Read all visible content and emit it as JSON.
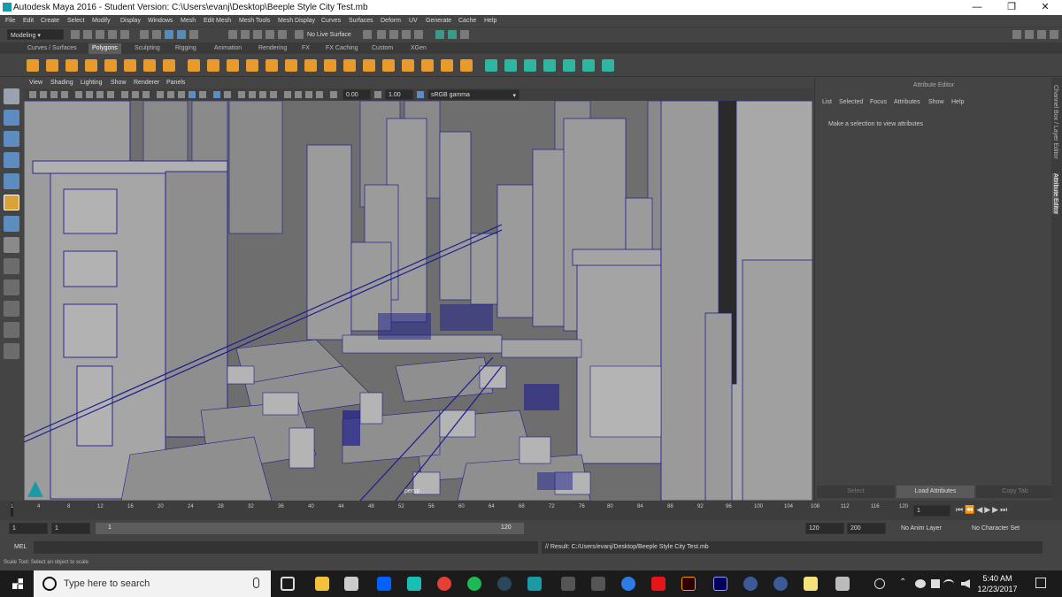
{
  "window": {
    "title": "Autodesk Maya 2016 - Student Version: C:\\Users\\evanj\\Desktop\\Beeple Style City Test.mb",
    "minimize": "—",
    "maximize": "❐",
    "close": "✕"
  },
  "menubar": [
    "File",
    "Edit",
    "Create",
    "Select",
    "Modify",
    "Display",
    "Windows",
    "Mesh",
    "Edit Mesh",
    "Mesh Tools",
    "Mesh Display",
    "Curves",
    "Surfaces",
    "Deform",
    "UV",
    "Generate",
    "Cache",
    "Help"
  ],
  "statusline": {
    "mode": "Modeling",
    "live_surface": "No Live Surface"
  },
  "shelf_tabs": [
    "Curves / Surfaces",
    "Polygons",
    "Sculpting",
    "Rigging",
    "Animation",
    "Rendering",
    "FX",
    "FX Caching",
    "Custom",
    "XGen"
  ],
  "shelf_active": "Polygons",
  "panel_menu": [
    "View",
    "Shading",
    "Lighting",
    "Show",
    "Renderer",
    "Panels"
  ],
  "panel_toolbar": {
    "exposure": "0.00",
    "gamma": "1.00",
    "colorspace": "sRGB gamma"
  },
  "viewport": {
    "camera": "persp"
  },
  "attribute_editor": {
    "title": "Attribute Editor",
    "menu": [
      "List",
      "Selected",
      "Focus",
      "Attributes",
      "Show",
      "Help"
    ],
    "hint": "Make a selection to view attributes",
    "buttons": [
      "Select",
      "Load Attributes",
      "Copy Tab"
    ]
  },
  "side_tabs": [
    "Channel Box / Layer Editor",
    "Attribute Editor"
  ],
  "timeline": {
    "ticks": [
      "1",
      "4",
      "8",
      "12",
      "16",
      "20",
      "24",
      "28",
      "32",
      "36",
      "40",
      "44",
      "48",
      "52",
      "56",
      "60",
      "64",
      "68",
      "72",
      "76",
      "80",
      "84",
      "88",
      "92",
      "96",
      "100",
      "104",
      "108",
      "112",
      "116",
      "120"
    ],
    "current": "1"
  },
  "range": {
    "start": "1",
    "playback_start": "1",
    "slider_start": "1",
    "slider_end": "120",
    "playback_end": "120",
    "end": "200",
    "anim_layer": "No Anim Layer",
    "char_set": "No Character Set"
  },
  "command": {
    "lang": "MEL",
    "result": "// Result: C:/Users/evanj/Desktop/Beeple Style City Test.mb"
  },
  "help_line": "Scale Tool: Select an object to scale",
  "taskbar": {
    "search": "Type here to search",
    "time": "5:40 AM",
    "date": "12/23/2017"
  },
  "colors": {
    "accent": "#3f6fa0",
    "wire": "#1c1c8c",
    "viewport": "#6e6e6e"
  }
}
